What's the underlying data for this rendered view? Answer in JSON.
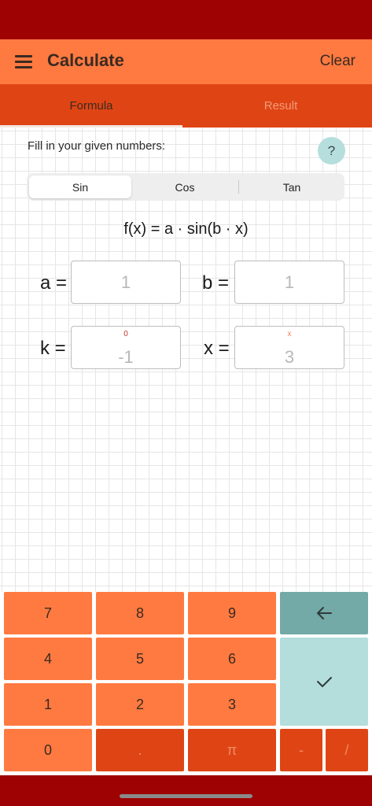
{
  "app_bar": {
    "title": "Calculate",
    "clear_label": "Clear",
    "menu_icon": "menu-icon"
  },
  "tabs": [
    {
      "label": "Formula",
      "selected": true
    },
    {
      "label": "Result",
      "selected": false
    }
  ],
  "instruction": "Fill in your given numbers:",
  "help_label": "?",
  "functions": [
    {
      "label": "Sin",
      "selected": true
    },
    {
      "label": "Cos",
      "selected": false
    },
    {
      "label": "Tan",
      "selected": false
    }
  ],
  "formula": "f(x) = a · sin(b · x)",
  "fields": {
    "a": {
      "label": "a =",
      "placeholder": "1"
    },
    "b": {
      "label": "b =",
      "placeholder": "1"
    },
    "k": {
      "label": "k =",
      "placeholder": "-1",
      "hint": "0"
    },
    "x": {
      "label": "x =",
      "placeholder": "3",
      "hint": "x"
    }
  },
  "keypad": {
    "row1": [
      "7",
      "8",
      "9"
    ],
    "row2": [
      "4",
      "5",
      "6"
    ],
    "row3": [
      "1",
      "2",
      "3"
    ],
    "row4": [
      "0",
      ".",
      "π",
      "-",
      "/"
    ],
    "backspace_icon": "backspace-arrow-icon",
    "confirm_icon": "checkmark-icon"
  },
  "colors": {
    "status_bar": "#9e0202",
    "app_bar": "#ff7a40",
    "tabs": "#df4514",
    "key_orange": "#ff7a40",
    "key_red": "#df4514",
    "key_teal_dark": "#73a9a6",
    "key_teal_light": "#b3dedc"
  }
}
